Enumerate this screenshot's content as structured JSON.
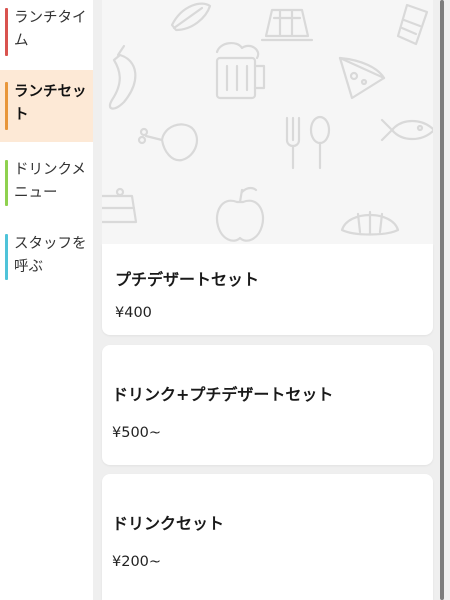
{
  "sidebar": {
    "items": [
      {
        "label": "ランチタイム",
        "color": "#d9534f"
      },
      {
        "label": "ランチセット",
        "color": "#e8963a",
        "active": true
      },
      {
        "label": "ドリンクメニュー",
        "color": "#8fd14f"
      },
      {
        "label": "スタッフを呼ぶ",
        "color": "#4fc3d9"
      }
    ]
  },
  "hero": {
    "pattern_icons": [
      "leaf-icon",
      "pudding-icon",
      "bread-icon",
      "chili-icon",
      "beer-mug-icon",
      "pizza-slice-icon",
      "chicken-leg-icon",
      "fork-spoon-icon",
      "fish-icon",
      "apple-icon",
      "croissant-icon",
      "cake-icon"
    ]
  },
  "menu": {
    "items": [
      {
        "title": "プチデザートセット",
        "price": "¥400"
      },
      {
        "title": "ドリンク+プチデザートセット",
        "price": "¥500~"
      },
      {
        "title": "ドリンクセット",
        "price": "¥200~"
      }
    ]
  },
  "colors": {
    "active_bg": "#fde9d6",
    "main_bg": "#efefef",
    "pattern_stroke": "#d9d9d9"
  }
}
